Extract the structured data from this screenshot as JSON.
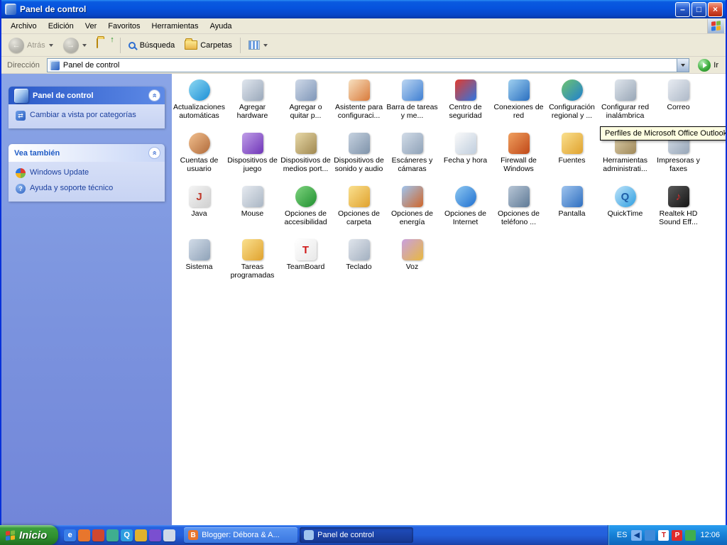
{
  "window": {
    "title": "Panel de control",
    "controls": {
      "minimize": "–",
      "maximize": "□",
      "close": "×"
    }
  },
  "menu_bar": {
    "items": [
      "Archivo",
      "Edición",
      "Ver",
      "Favoritos",
      "Herramientas",
      "Ayuda"
    ]
  },
  "toolbar": {
    "back_label": "Atrás",
    "search_label": "Búsqueda",
    "folders_label": "Carpetas"
  },
  "address_bar": {
    "label": "Dirección",
    "value": "Panel de control",
    "go_label": "Ir"
  },
  "sidebar": {
    "panel1": {
      "title": "Panel de control",
      "links": [
        {
          "label": "Cambiar a vista por categorías"
        }
      ]
    },
    "panel2": {
      "title": "Vea también",
      "links": [
        {
          "label": "Windows Update"
        },
        {
          "label": "Ayuda y soporte técnico"
        }
      ]
    }
  },
  "main": {
    "items": [
      {
        "label": "Actualizaciones automáticas",
        "icon": "automatic-updates-icon",
        "shape": "circle",
        "c1": "#8fd9f2",
        "c2": "#1b8ed6",
        "glyph": ""
      },
      {
        "label": "Agregar hardware",
        "icon": "add-hardware-icon",
        "shape": "square",
        "c1": "#e0e6ee",
        "c2": "#9aa8ba",
        "glyph": ""
      },
      {
        "label": "Agregar o quitar p...",
        "icon": "add-remove-programs-icon",
        "shape": "square",
        "c1": "#cfd9e8",
        "c2": "#7f96b8",
        "glyph": ""
      },
      {
        "label": "Asistente para configuraci...",
        "icon": "network-setup-wizard-icon",
        "shape": "square",
        "c1": "#f7e0c0",
        "c2": "#d97a3a",
        "glyph": ""
      },
      {
        "label": "Barra de tareas y me...",
        "icon": "taskbar-start-menu-icon",
        "shape": "square",
        "c1": "#bcd6f2",
        "c2": "#3f7fd2",
        "glyph": ""
      },
      {
        "label": "Centro de seguridad",
        "icon": "security-center-icon",
        "shape": "square",
        "c1": "#e23b2e",
        "c2": "#2e76e2",
        "glyph": ""
      },
      {
        "label": "Conexiones de red",
        "icon": "network-connections-icon",
        "shape": "square",
        "c1": "#9fd0f0",
        "c2": "#2a6fc0",
        "glyph": ""
      },
      {
        "label": "Configuración regional y ...",
        "icon": "regional-settings-icon",
        "shape": "circle",
        "c1": "#6fc46f",
        "c2": "#1f7fd0",
        "glyph": ""
      },
      {
        "label": "Configurar red inalámbrica",
        "icon": "wireless-network-setup-icon",
        "shape": "square",
        "c1": "#dfe5ec",
        "c2": "#98a6b6",
        "glyph": ""
      },
      {
        "label": "Correo",
        "icon": "mail-icon",
        "shape": "square",
        "c1": "#e8ecf2",
        "c2": "#aeb9c8",
        "glyph": ""
      },
      {
        "label": "Cuentas de usuario",
        "icon": "user-accounts-icon",
        "shape": "circle",
        "c1": "#f2c08f",
        "c2": "#b06a3a",
        "glyph": ""
      },
      {
        "label": "Dispositivos de juego",
        "icon": "game-controllers-icon",
        "shape": "square",
        "c1": "#c09fe8",
        "c2": "#6f35b8",
        "glyph": ""
      },
      {
        "label": "Dispositivos de medios port...",
        "icon": "portable-media-devices-icon",
        "shape": "square",
        "c1": "#e8d9a8",
        "c2": "#a08850",
        "glyph": ""
      },
      {
        "label": "Dispositivos de sonido y audio",
        "icon": "sounds-audio-devices-icon",
        "shape": "square",
        "c1": "#c6d2e0",
        "c2": "#7f93aa",
        "glyph": ""
      },
      {
        "label": "Escáneres y cámaras",
        "icon": "scanners-cameras-icon",
        "shape": "square",
        "c1": "#d2dce8",
        "c2": "#8fa2b8",
        "glyph": ""
      },
      {
        "label": "Fecha y hora",
        "icon": "date-time-icon",
        "shape": "square",
        "c1": "#fafafa",
        "c2": "#c0cede",
        "glyph": ""
      },
      {
        "label": "Firewall de Windows",
        "icon": "windows-firewall-icon",
        "shape": "square",
        "c1": "#f0a05f",
        "c2": "#c04818",
        "glyph": ""
      },
      {
        "label": "Fuentes",
        "icon": "fonts-icon",
        "shape": "square",
        "c1": "#fae08f",
        "c2": "#e0a22e",
        "glyph": ""
      },
      {
        "label": "Herramientas administrati...",
        "icon": "administrative-tools-icon",
        "shape": "square",
        "c1": "#e0d2b0",
        "c2": "#9f8858",
        "glyph": ""
      },
      {
        "label": "Impresoras y faxes",
        "icon": "printers-faxes-icon",
        "shape": "square",
        "c1": "#d6dee8",
        "c2": "#97a6b8",
        "glyph": ""
      },
      {
        "label": "Java",
        "icon": "java-icon",
        "shape": "square",
        "c1": "#f5f5f5",
        "c2": "#d0d0d0",
        "glyph": "J",
        "glyph_color": "#c0392b"
      },
      {
        "label": "Mouse",
        "icon": "mouse-icon",
        "shape": "square",
        "c1": "#e6eaf0",
        "c2": "#aab6c4",
        "glyph": ""
      },
      {
        "label": "Opciones de accesibilidad",
        "icon": "accessibility-options-icon",
        "shape": "circle",
        "c1": "#7fd47f",
        "c2": "#1f8f2f",
        "glyph": ""
      },
      {
        "label": "Opciones de carpeta",
        "icon": "folder-options-icon",
        "shape": "square",
        "c1": "#fae08f",
        "c2": "#e0a22e",
        "glyph": ""
      },
      {
        "label": "Opciones de energía",
        "icon": "power-options-icon",
        "shape": "square",
        "c1": "#9fc4ee",
        "c2": "#d0662a",
        "glyph": ""
      },
      {
        "label": "Opciones de Internet",
        "icon": "internet-options-icon",
        "shape": "circle",
        "c1": "#8fc9f2",
        "c2": "#1f6fd0",
        "glyph": ""
      },
      {
        "label": "Opciones de teléfono ...",
        "icon": "phone-modem-options-icon",
        "shape": "square",
        "c1": "#b8c6d6",
        "c2": "#5f7a96",
        "glyph": ""
      },
      {
        "label": "Pantalla",
        "icon": "display-icon",
        "shape": "square",
        "c1": "#9fc4ee",
        "c2": "#2f6fc0",
        "glyph": ""
      },
      {
        "label": "QuickTime",
        "icon": "quicktime-icon",
        "shape": "circle",
        "c1": "#bfe4fa",
        "c2": "#2f9ee0",
        "glyph": "Q",
        "glyph_color": "#1f5fa8"
      },
      {
        "label": "Realtek HD Sound Eff...",
        "icon": "realtek-sound-icon",
        "shape": "square",
        "c1": "#5a5a5a",
        "c2": "#141414",
        "glyph": "♪",
        "glyph_color": "#e02a2a"
      },
      {
        "label": "Sistema",
        "icon": "system-icon",
        "shape": "square",
        "c1": "#d2dce8",
        "c2": "#8fa2b8",
        "glyph": ""
      },
      {
        "label": "Tareas programadas",
        "icon": "scheduled-tasks-icon",
        "shape": "square",
        "c1": "#fae08f",
        "c2": "#e0a22e",
        "glyph": ""
      },
      {
        "label": "TeamBoard",
        "icon": "teamboard-icon",
        "shape": "square",
        "c1": "#ffffff",
        "c2": "#e8e8e8",
        "glyph": "T",
        "glyph_color": "#d01818"
      },
      {
        "label": "Teclado",
        "icon": "keyboard-icon",
        "shape": "square",
        "c1": "#e0e5ec",
        "c2": "#a3b0c0",
        "glyph": ""
      },
      {
        "label": "Voz",
        "icon": "speech-icon",
        "shape": "square",
        "c1": "#c9a0e0",
        "c2": "#e8b83f",
        "glyph": ""
      }
    ]
  },
  "tooltip": {
    "text": "Perfiles de Microsoft Office Outlook"
  },
  "taskbar": {
    "start_label": "Inicio",
    "quick_launch": [
      {
        "name": "internet-explorer-icon",
        "bg": "#3a7fe8",
        "glyph": "e"
      },
      {
        "name": "firefox-icon",
        "bg": "#e8762d",
        "glyph": ""
      },
      {
        "name": "media-player-icon",
        "bg": "#d0482f",
        "glyph": ""
      },
      {
        "name": "messenger-icon",
        "bg": "#3fae8f",
        "glyph": ""
      },
      {
        "name": "quicktime-icon",
        "bg": "#2f9ee0",
        "glyph": "Q"
      },
      {
        "name": "mail-app-icon",
        "bg": "#e0b22d",
        "glyph": ""
      },
      {
        "name": "browser-icon",
        "bg": "#7a4fd0",
        "glyph": ""
      },
      {
        "name": "show-desktop-icon",
        "bg": "#cfd9e8",
        "glyph": ""
      }
    ],
    "tasks": [
      {
        "label": "Blogger: Débora & A...",
        "icon": "blogger-task-icon",
        "icon_bg": "#e8762d",
        "glyph": "B",
        "glyph_color": "#ffffff",
        "active": false
      },
      {
        "label": "Panel de control",
        "icon": "control-panel-task-icon",
        "icon_bg": "#9fc4ee",
        "glyph": "",
        "glyph_color": "#ffffff",
        "active": true
      }
    ],
    "tray": {
      "lang": "ES",
      "time": "12:06",
      "icons": [
        {
          "name": "volume-icon",
          "bg": "#7fb3f0",
          "glyph": "◀",
          "color": "#0a3f8f"
        },
        {
          "name": "network-status-icon",
          "bg": "#3f8ad9",
          "glyph": "",
          "color": "#ffffff"
        },
        {
          "name": "teamboard-tray-icon",
          "bg": "#ffffff",
          "glyph": "T",
          "color": "#d01818"
        },
        {
          "name": "antivirus-tray-icon",
          "bg": "#e02a2a",
          "glyph": "P",
          "color": "#ffffff"
        },
        {
          "name": "update-tray-icon",
          "bg": "#3fae4f",
          "glyph": "",
          "color": "#ffffff"
        }
      ]
    }
  }
}
